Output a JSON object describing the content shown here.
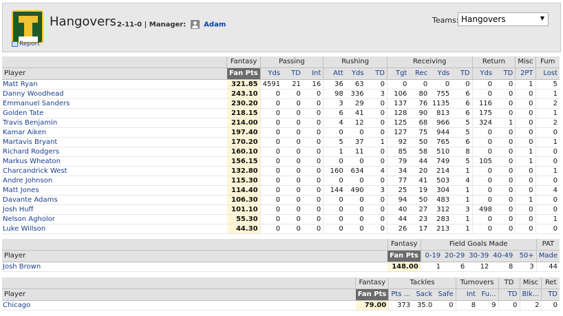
{
  "header": {
    "team_name": "Hangovers",
    "record": "2-11-0",
    "manager_label": "| Manager:",
    "manager": "Adam",
    "report": "Report",
    "teams_label": "Teams:",
    "teams_selected": "Hangovers"
  },
  "offense": {
    "groups": [
      "Fantasy",
      "Passing",
      "Rushing",
      "Receiving",
      "Return",
      "Misc",
      "Fum"
    ],
    "columns": [
      "Player",
      "Fan Pts",
      "Yds",
      "TD",
      "Int",
      "Att",
      "Yds",
      "TD",
      "Tgt",
      "Rec",
      "Yds",
      "TD",
      "Yds",
      "TD",
      "2PT",
      "Lost"
    ],
    "rows": [
      [
        "Matt Ryan",
        "321.85",
        "4591",
        "21",
        "16",
        "36",
        "63",
        "0",
        "0",
        "0",
        "0",
        "0",
        "0",
        "0",
        "1",
        "5"
      ],
      [
        "Danny Woodhead",
        "243.10",
        "0",
        "0",
        "0",
        "98",
        "336",
        "3",
        "106",
        "80",
        "755",
        "6",
        "0",
        "0",
        "0",
        "1"
      ],
      [
        "Emmanuel Sanders",
        "230.20",
        "0",
        "0",
        "0",
        "3",
        "29",
        "0",
        "137",
        "76",
        "1135",
        "6",
        "116",
        "0",
        "0",
        "2"
      ],
      [
        "Golden Tate",
        "218.15",
        "0",
        "0",
        "0",
        "6",
        "41",
        "0",
        "128",
        "90",
        "813",
        "6",
        "175",
        "0",
        "0",
        "1"
      ],
      [
        "Travis Benjamin",
        "214.00",
        "0",
        "0",
        "0",
        "4",
        "12",
        "0",
        "125",
        "68",
        "966",
        "5",
        "324",
        "1",
        "0",
        "2"
      ],
      [
        "Kamar Aiken",
        "197.40",
        "0",
        "0",
        "0",
        "0",
        "0",
        "0",
        "127",
        "75",
        "944",
        "5",
        "0",
        "0",
        "0",
        "0"
      ],
      [
        "Martavis Bryant",
        "170.20",
        "0",
        "0",
        "0",
        "5",
        "37",
        "1",
        "92",
        "50",
        "765",
        "6",
        "0",
        "0",
        "0",
        "1"
      ],
      [
        "Richard Rodgers",
        "160.10",
        "0",
        "0",
        "0",
        "1",
        "11",
        "0",
        "85",
        "58",
        "510",
        "8",
        "0",
        "0",
        "1",
        "0"
      ],
      [
        "Markus Wheaton",
        "156.15",
        "0",
        "0",
        "0",
        "0",
        "0",
        "0",
        "79",
        "44",
        "749",
        "5",
        "105",
        "0",
        "1",
        "0"
      ],
      [
        "Charcandrick West",
        "132.80",
        "0",
        "0",
        "0",
        "160",
        "634",
        "4",
        "34",
        "20",
        "214",
        "1",
        "0",
        "0",
        "0",
        "1"
      ],
      [
        "Andre Johnson",
        "115.30",
        "0",
        "0",
        "0",
        "0",
        "0",
        "0",
        "77",
        "41",
        "503",
        "4",
        "0",
        "0",
        "0",
        "0"
      ],
      [
        "Matt Jones",
        "114.40",
        "0",
        "0",
        "0",
        "144",
        "490",
        "3",
        "25",
        "19",
        "304",
        "1",
        "0",
        "0",
        "0",
        "4"
      ],
      [
        "Davante Adams",
        "106.30",
        "0",
        "0",
        "0",
        "0",
        "0",
        "0",
        "94",
        "50",
        "483",
        "1",
        "0",
        "0",
        "1",
        "0"
      ],
      [
        "Josh Huff",
        "101.10",
        "0",
        "0",
        "0",
        "0",
        "0",
        "0",
        "40",
        "27",
        "312",
        "3",
        "498",
        "0",
        "0",
        "0"
      ],
      [
        "Nelson Agholor",
        "55.30",
        "0",
        "0",
        "0",
        "0",
        "0",
        "0",
        "44",
        "23",
        "283",
        "1",
        "0",
        "0",
        "0",
        "1"
      ],
      [
        "Luke Willson",
        "44.30",
        "0",
        "0",
        "0",
        "0",
        "0",
        "0",
        "26",
        "17",
        "213",
        "1",
        "0",
        "0",
        "0",
        "0"
      ]
    ]
  },
  "kicker": {
    "groups": [
      "Fantasy",
      "Field Goals Made",
      "PAT"
    ],
    "columns": [
      "Player",
      "Fan Pts",
      "0-19",
      "20-29",
      "30-39",
      "40-49",
      "50+",
      "Made"
    ],
    "rows": [
      [
        "Josh Brown",
        "148.00",
        "1",
        "6",
        "12",
        "8",
        "3",
        "44"
      ]
    ]
  },
  "defense": {
    "groups": [
      "Fantasy",
      "Tackles",
      "Turnovers",
      "TD",
      "Misc",
      "Ret"
    ],
    "columns": [
      "Player",
      "Fan Pts",
      "Pts ...",
      "Sack",
      "Safe",
      "Int",
      "Fu...",
      "TD",
      "Blk...",
      "TD"
    ],
    "rows": [
      [
        "Chicago",
        "79.00",
        "373",
        "35.0",
        "0",
        "8",
        "9",
        "0",
        "2",
        "0"
      ]
    ]
  }
}
